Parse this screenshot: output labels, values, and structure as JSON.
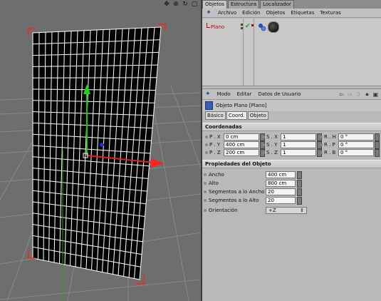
{
  "viewport": {
    "toolbar_icons": [
      "move-icon",
      "rotate-icon",
      "zoom-icon",
      "maximize-icon"
    ],
    "toolbar_glyphs": [
      "✥",
      "⊕",
      "↻",
      "▢"
    ]
  },
  "tabs": [
    "Objetos",
    "Estructura",
    "Localizador"
  ],
  "object_menu": [
    "Archivo",
    "Edición",
    "Objetos",
    "Etiquetas",
    "Texturas"
  ],
  "object": {
    "name": "Plano"
  },
  "attr_menu": [
    "Modo",
    "Editar",
    "Datos de Usuario"
  ],
  "attr_title": "Objeto Plano [Plano]",
  "subtabs": [
    "Básico",
    "Coord.",
    "Objeto"
  ],
  "coords": {
    "header": "Coordenadas",
    "rows": [
      [
        {
          "label": "P . X",
          "value": "0 cm"
        },
        {
          "label": "S . X",
          "value": "1"
        },
        {
          "label": "R . H",
          "value": "0 °"
        }
      ],
      [
        {
          "label": "P . Y",
          "value": "400 cm"
        },
        {
          "label": "S . Y",
          "value": "1"
        },
        {
          "label": "R . P",
          "value": "0 °"
        }
      ],
      [
        {
          "label": "P . Z",
          "value": "200 cm"
        },
        {
          "label": "S . Z",
          "value": "1"
        },
        {
          "label": "R . B",
          "value": "0 °"
        }
      ]
    ]
  },
  "props": {
    "header": "Propiedades del Objeto",
    "rows": [
      {
        "label": "Ancho",
        "value": "400 cm"
      },
      {
        "label": "Alto",
        "value": "800 cm"
      },
      {
        "label": "Segmentos a lo Ancho",
        "value": "20"
      },
      {
        "label": "Segmentos a lo Alto",
        "value": "20"
      }
    ],
    "orientation_label": "Orientación",
    "orientation_value": "+Z"
  }
}
